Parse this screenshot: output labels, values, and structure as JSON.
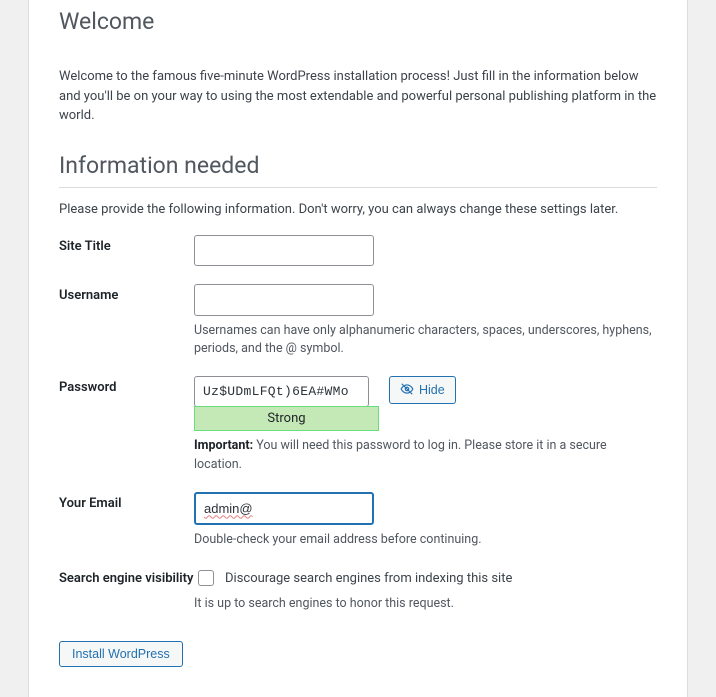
{
  "welcome": {
    "heading": "Welcome",
    "intro": "Welcome to the famous five-minute WordPress installation process! Just fill in the information below and you'll be on your way to using the most extendable and powerful personal publishing platform in the world."
  },
  "info": {
    "heading": "Information needed",
    "intro": "Please provide the following information. Don't worry, you can always change these settings later."
  },
  "fields": {
    "site_title": {
      "label": "Site Title",
      "value": ""
    },
    "username": {
      "label": "Username",
      "value": "",
      "hint": "Usernames can have only alphanumeric characters, spaces, underscores, hyphens, periods, and the @ symbol."
    },
    "password": {
      "label": "Password",
      "value": "Uz$UDmLFQt)6EA#WMo",
      "strength": "Strong",
      "hide_button": "Hide",
      "hint_strong": "Important:",
      "hint_rest": " You will need this password to log in. Please store it in a secure location."
    },
    "email": {
      "label": "Your Email",
      "value": "admin@",
      "hint": "Double-check your email address before continuing."
    },
    "visibility": {
      "label": "Search engine visibility",
      "checkbox_label": "Discourage search engines from indexing this site",
      "checked": false,
      "hint": "It is up to search engines to honor this request."
    }
  },
  "submit": {
    "label": "Install WordPress"
  }
}
